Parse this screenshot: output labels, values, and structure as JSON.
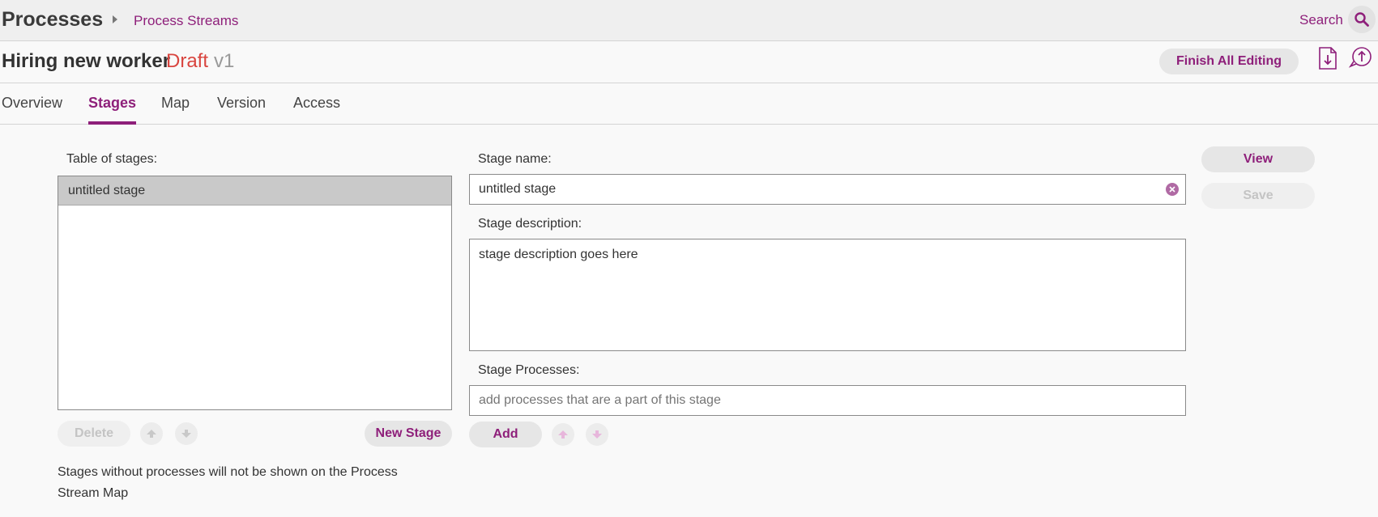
{
  "header": {
    "app_title": "Processes",
    "breadcrumb": "Process Streams",
    "search_label": "Search"
  },
  "document": {
    "title": "Hiring new worker",
    "status": "Draft",
    "version": "v1",
    "finish_label": "Finish All Editing"
  },
  "tabs": [
    {
      "label": "Overview"
    },
    {
      "label": "Stages"
    },
    {
      "label": "Map"
    },
    {
      "label": "Version"
    },
    {
      "label": "Access"
    }
  ],
  "stages_panel": {
    "label": "Table of stages:",
    "items": [
      {
        "label": "untitled stage"
      }
    ],
    "delete_label": "Delete",
    "new_stage_label": "New Stage",
    "note": "Stages without processes will not be shown on the Process Stream Map"
  },
  "editor": {
    "name_label": "Stage name:",
    "name_value": "untitled stage",
    "description_label": "Stage description:",
    "description_value": "stage description goes here",
    "processes_label": "Stage Processes:",
    "processes_placeholder": "add processes that are a part of this stage",
    "add_label": "Add"
  },
  "actions": {
    "view_label": "View",
    "save_label": "Save"
  },
  "colors": {
    "accent": "#8e1f7a",
    "draft": "#d9453f"
  },
  "icons": [
    "search-icon",
    "download-icon",
    "upload-icon",
    "arrow-up-icon",
    "arrow-down-icon",
    "clear-icon"
  ]
}
